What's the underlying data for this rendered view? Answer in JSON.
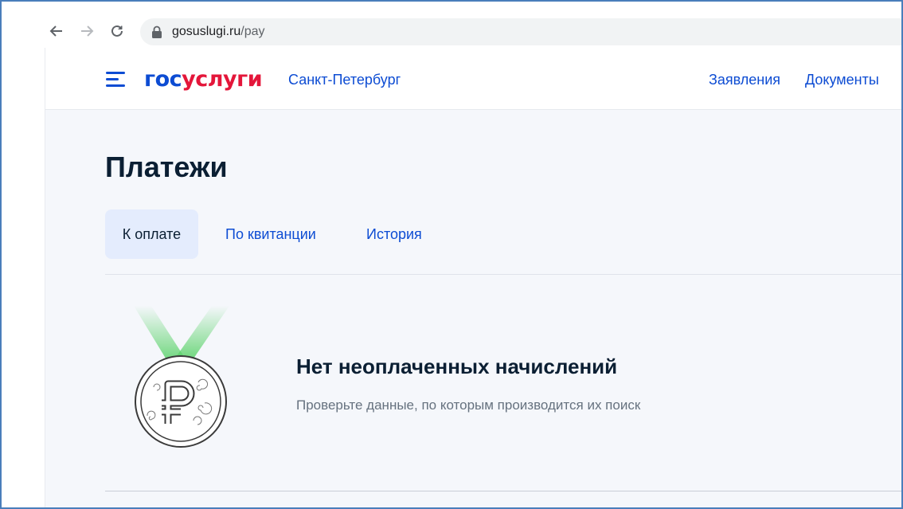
{
  "browser": {
    "url_host": "gosuslugi.ru",
    "url_path": "/pay"
  },
  "header": {
    "logo_part1": "гос",
    "logo_part2": "услуги",
    "region": "Санкт-Петербург",
    "nav": [
      "Заявления",
      "Документы"
    ]
  },
  "main": {
    "title": "Платежи",
    "tabs": [
      {
        "label": "К оплате",
        "active": true
      },
      {
        "label": "По квитанции",
        "active": false
      },
      {
        "label": "История",
        "active": false
      }
    ],
    "empty_state": {
      "icon": "ruble-medal-icon",
      "title": "Нет неоплаченных начислений",
      "text": "Проверьте данные, по которым производится их поиск"
    }
  },
  "colors": {
    "brand_blue": "#0d4cd3",
    "brand_red": "#e4163a",
    "ribbon_green": "#5fd36e",
    "page_bg": "#f5f7fb",
    "tab_active_bg": "#e4ecfd"
  }
}
